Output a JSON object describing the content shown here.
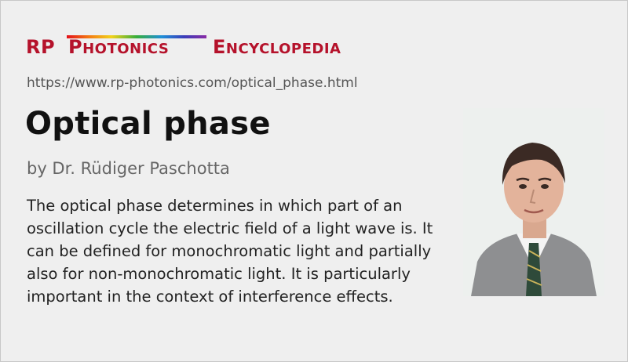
{
  "brand": {
    "rp": "RP",
    "photonics_initial": "P",
    "photonics_rest": "HOTONICS",
    "encyclopedia_initial": "E",
    "encyclopedia_rest": "NCYCLOPEDIA",
    "color": "#b5122b"
  },
  "page": {
    "url": "https://www.rp-photonics.com/optical_phase.html",
    "title": "Optical phase",
    "author": "by Dr. Rüdiger Paschotta",
    "summary": "The optical phase determines in which part of an oscillation cycle the electric field of a light wave is. It can be defined for monochromatic light and partially also for non-monochromatic light. It is particularly important in the context of interference effects."
  },
  "photo": {
    "description_icon": "author-portrait"
  }
}
